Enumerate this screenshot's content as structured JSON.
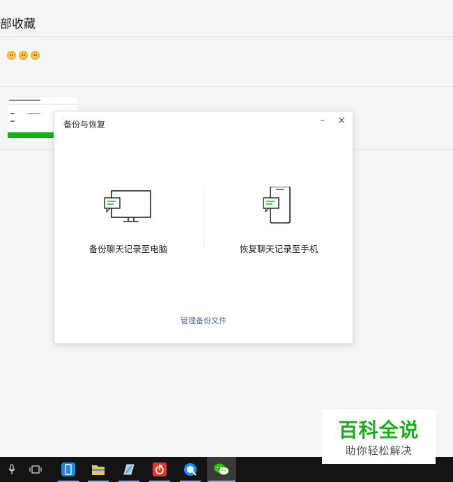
{
  "background": {
    "section_title": "部收藏"
  },
  "dialog": {
    "title": "备份与恢复",
    "minimize_glyph": "–",
    "close_glyph": "×",
    "backup_option": {
      "label": "备份聊天记录至电脑",
      "icon": "monitor-chat-icon"
    },
    "restore_option": {
      "label": "恢复聊天记录至手机",
      "icon": "phone-chat-icon"
    },
    "manage_link": "管理备份文件"
  },
  "taskbar": {
    "items": [
      "microphone-icon",
      "task-view-icon",
      "phone-app-icon",
      "file-explorer-icon",
      "pen-app-icon",
      "netease-music-icon",
      "browser-icon",
      "wechat-icon"
    ]
  },
  "watermark": {
    "main": "百科全说",
    "sub": "助你轻松解决"
  },
  "colors": {
    "accent_green": "#1aad19",
    "link_blue": "#576b95",
    "taskbar": "#141414"
  }
}
